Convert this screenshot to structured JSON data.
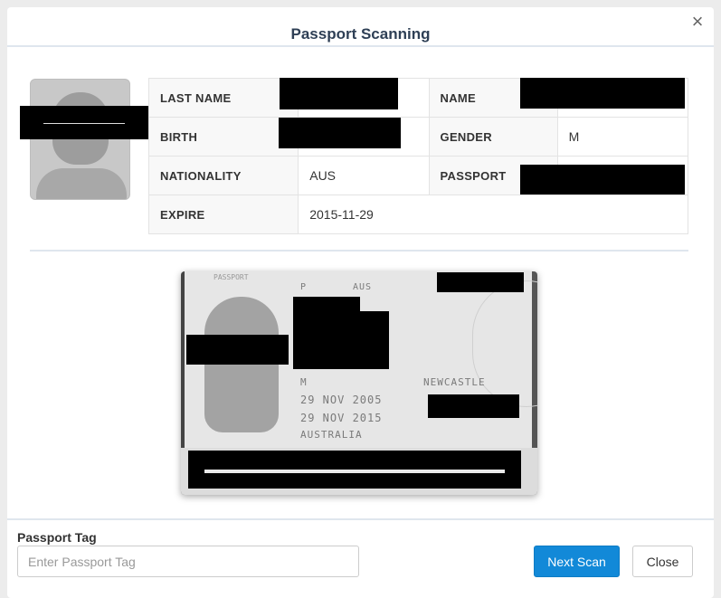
{
  "dialog": {
    "title": "Passport Scanning",
    "close_icon": "×"
  },
  "fields": {
    "last_name": {
      "label": "LAST NAME",
      "value": ""
    },
    "name": {
      "label": "NAME",
      "value": ""
    },
    "birth": {
      "label": "BIRTH",
      "value": ""
    },
    "gender": {
      "label": "GENDER",
      "value": "M"
    },
    "nationality": {
      "label": "NATIONALITY",
      "value": "AUS"
    },
    "passport": {
      "label": "PASSPORT",
      "value": ""
    },
    "expire": {
      "label": "EXPIRE",
      "value": "2015-11-29"
    }
  },
  "scan_text": {
    "header": "PASSPORT",
    "type": "P",
    "country": "AUS",
    "sex": "M",
    "place_of_birth": "NEWCASTLE",
    "issue_date": "29 NOV 2005",
    "expiry_date": "29 NOV 2015",
    "issuing_authority": "AUSTRALIA"
  },
  "footer": {
    "tag_label": "Passport Tag",
    "tag_placeholder": "Enter Passport Tag",
    "tag_value": "",
    "next_scan": "Next Scan",
    "close": "Close"
  },
  "colors": {
    "primary": "#1289d8",
    "title": "#2e3f55",
    "redaction": "#000000"
  }
}
